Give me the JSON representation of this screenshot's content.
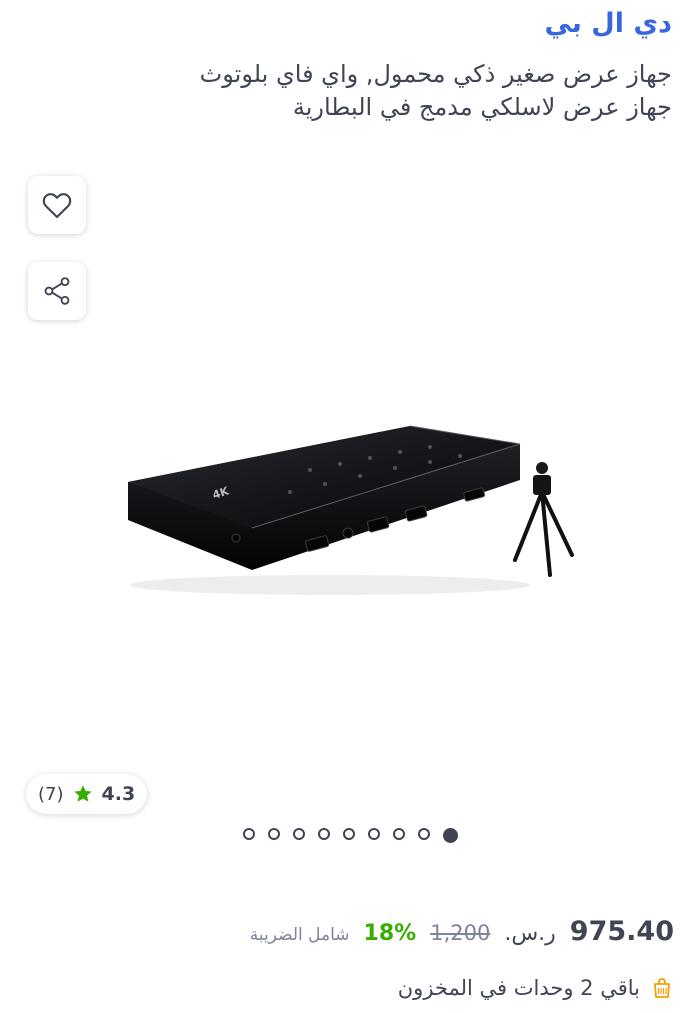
{
  "brand": "دي ال بي",
  "title": {
    "line1": "جهاز عرض صغير ذكي محمول, واي فاي بلوتوث",
    "line2": "جهاز عرض لاسلكي مدمج في البطارية"
  },
  "actions": {
    "wishlist_icon": "heart-icon",
    "share_icon": "share-icon"
  },
  "product_image": {
    "device_label": "4K"
  },
  "rating": {
    "value": "4.3",
    "count": "(7)",
    "star_color": "#38ae04"
  },
  "carousel": {
    "total": 9,
    "active_index": 0
  },
  "price": {
    "value": "975.40",
    "currency": "ر.س.",
    "old": "1,200",
    "discount": "18%",
    "tax_note": "شامل الضريبة"
  },
  "stock": {
    "text": "باقي 2 وحدات في المخزون",
    "icon": "shopping-bag-icon",
    "icon_color": "#f6a000"
  },
  "colors": {
    "brand": "#3866df",
    "text": "#404553",
    "discount": "#38ae04",
    "muted": "#7e859b"
  }
}
